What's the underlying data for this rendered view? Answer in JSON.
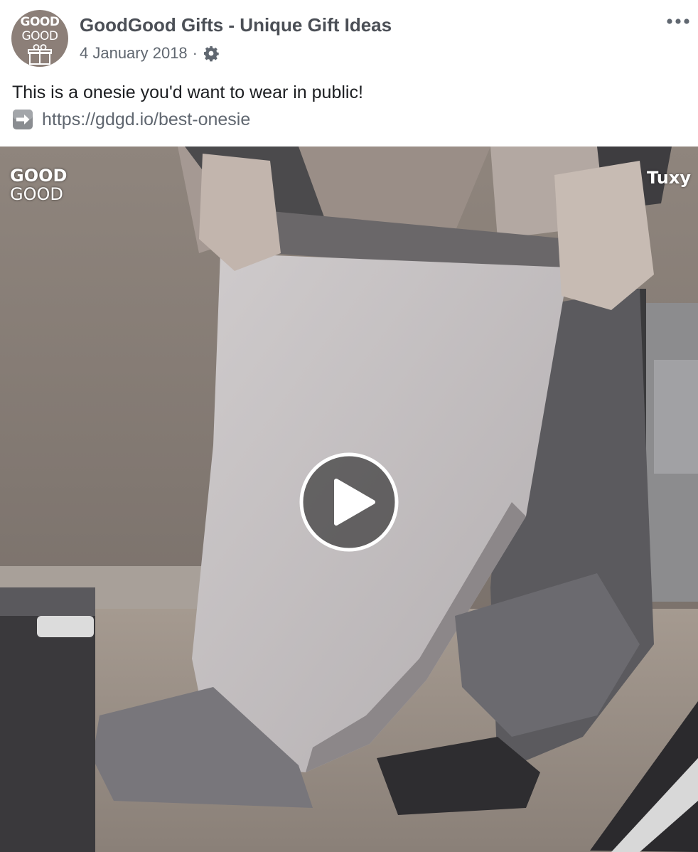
{
  "post": {
    "page_name": "GoodGood Gifts - Unique Gift Ideas",
    "date": "4 January 2018",
    "separator": "·",
    "audience_icon": "gear-icon",
    "more_icon": "more-options-icon",
    "avatar": {
      "logo_line1": "GOOD",
      "logo_line2": "GOOD",
      "icon": "gift-icon"
    },
    "message": "This is a onesie you'd want to wear in public!",
    "link_emoji": "right-arrow-emoji",
    "link_text": "https://gdgd.io/best-onesie"
  },
  "video": {
    "watermark_line1": "GOOD",
    "watermark_line2": "GOOD",
    "brand_tag": "Tuxy",
    "play_icon": "play-icon"
  },
  "colors": {
    "page_name": "#4b4f56",
    "meta_text": "#606770",
    "avatar_bg": "#8c7f78"
  }
}
